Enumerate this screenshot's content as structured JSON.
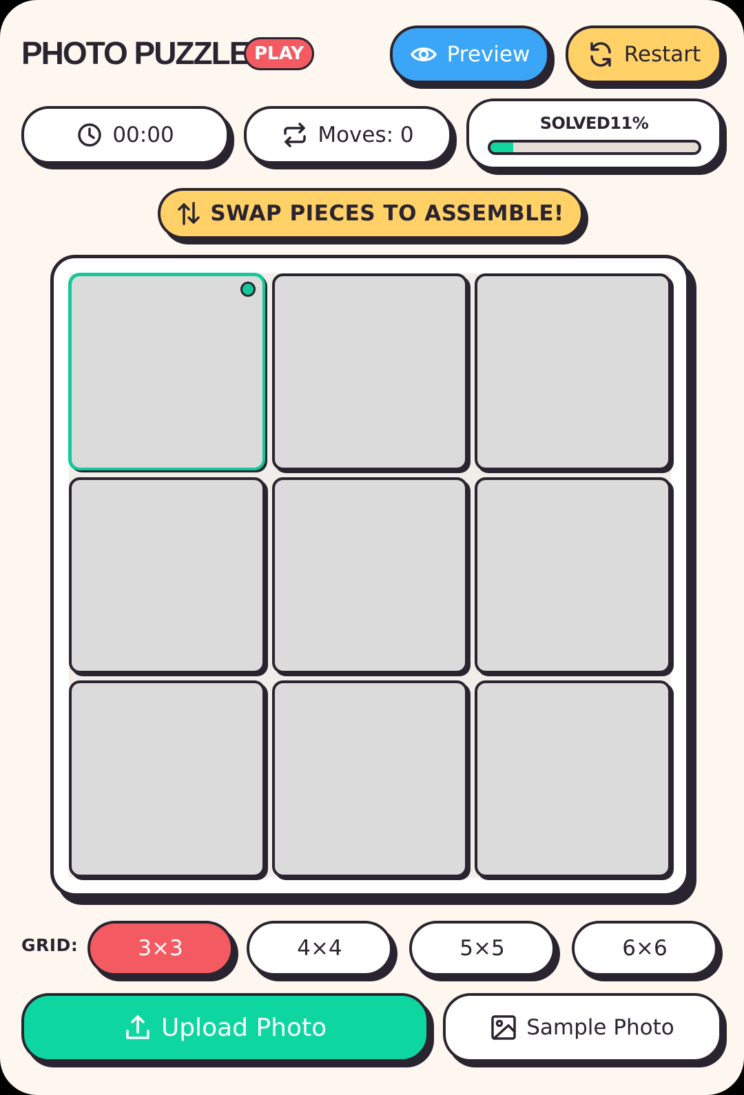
{
  "header": {
    "title": "PHOTO PUZZLE",
    "badge": "PLAY"
  },
  "actions": {
    "preview": {
      "label": "Preview",
      "icon": "eye-icon"
    },
    "restart": {
      "label": "Restart",
      "icon": "refresh-icon"
    }
  },
  "stats": {
    "timer": {
      "value": "00:00",
      "icon": "clock-icon"
    },
    "moves": {
      "label": "Moves: 0",
      "icon": "repeat-icon"
    },
    "progress": {
      "label": "SOLVED11%",
      "fraction": 0.11
    }
  },
  "hint": {
    "text": "SWAP PIECES TO ASSEMBLE!",
    "icon": "swap-vertical-icon"
  },
  "board": {
    "rows": 3,
    "cols": 3,
    "selected_index": 0,
    "tiles": [
      "",
      "",
      "",
      "",
      "",
      "",
      "",
      "",
      ""
    ]
  },
  "grid_size": {
    "label": "GRID:",
    "options": [
      "3×3",
      "4×4",
      "5×5",
      "6×6"
    ],
    "selected": "3×3"
  },
  "footer": {
    "upload": {
      "label": "Upload Photo",
      "icon": "upload-icon"
    },
    "sample": {
      "label": "Sample Photo",
      "icon": "image-icon"
    }
  },
  "colors": {
    "background": "#fdf7ef",
    "ink": "#2a2430",
    "accent_red": "#f35a62",
    "accent_blue": "#3ba6f7",
    "accent_yellow": "#ffd166",
    "accent_green": "#0ed6a0",
    "tile": "#dbdbdb"
  }
}
